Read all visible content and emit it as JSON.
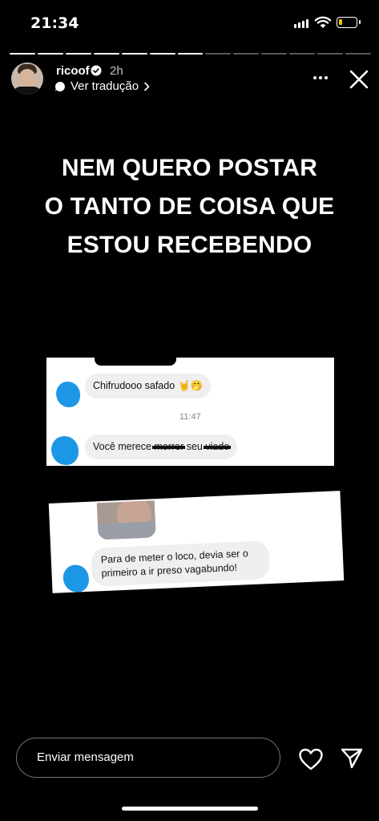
{
  "status": {
    "time": "21:34"
  },
  "story": {
    "segments_total": 13,
    "segments_done": 7
  },
  "header": {
    "username": "ricoof",
    "time_ago": "2h",
    "translate_label": "Ver tradução"
  },
  "headline": {
    "line1": "NEM QUERO POSTAR",
    "line2": "O TANTO DE COISA QUE",
    "line3": "ESTOU RECEBENDO"
  },
  "screenshot1": {
    "message1": "Chifrudooo safado",
    "message1_emoji": "🤘🤭",
    "timestamp": "11:47",
    "message2_before": "Você merece ",
    "message2_struck1": "morrer",
    "message2_mid": " seu ",
    "message2_struck2": "viado"
  },
  "screenshot2": {
    "message": "Para de meter o loco, devia ser o primeiro a ir preso vagabundo!"
  },
  "footer": {
    "reply_placeholder": "Enviar mensagem"
  },
  "colors": {
    "redaction_blob": "#1c97e6",
    "battery": "#f2c200"
  },
  "icons": [
    "signal-icon",
    "wifi-icon",
    "battery-icon",
    "verified-icon",
    "translate-icon",
    "chevron-right-icon",
    "more-icon",
    "close-icon",
    "heart-icon",
    "send-icon"
  ]
}
